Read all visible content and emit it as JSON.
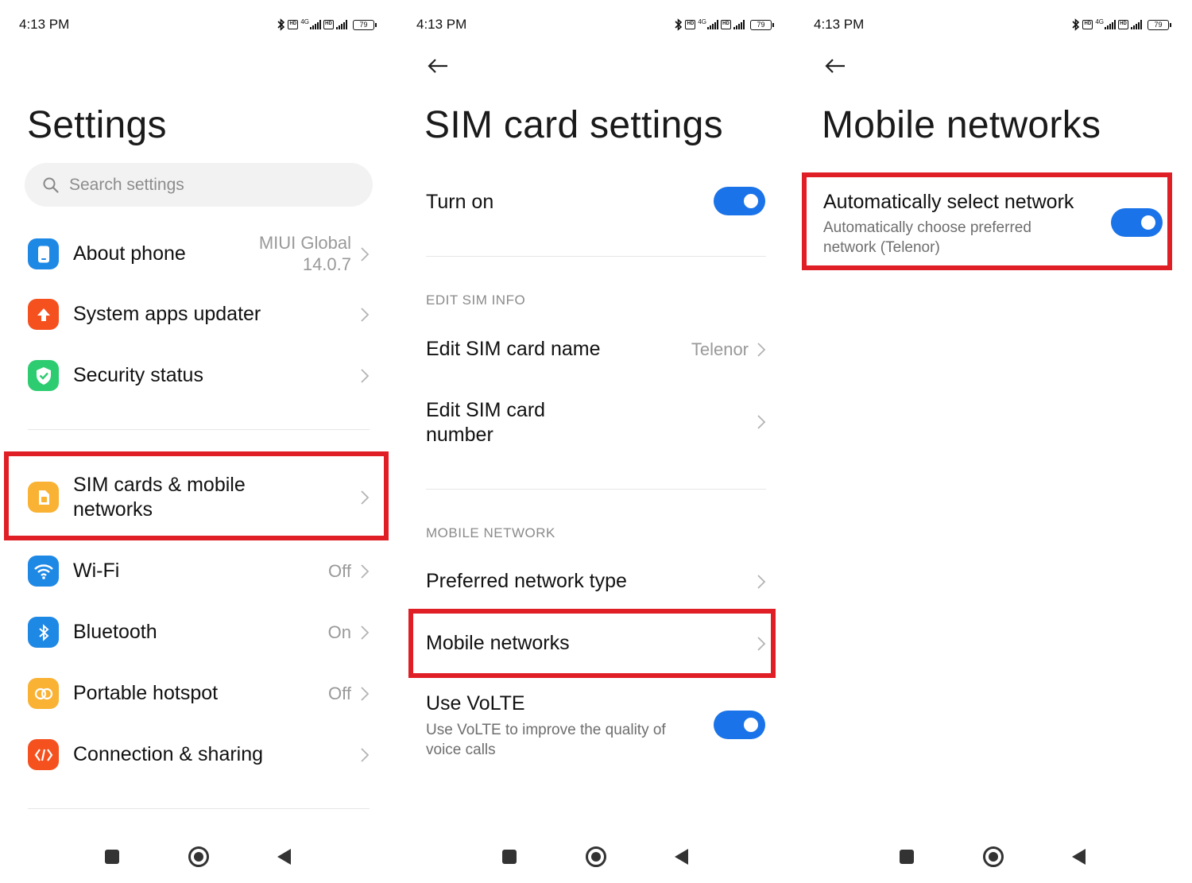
{
  "status_bar": {
    "time": "4:13 PM",
    "battery": "79",
    "network_label": "4G"
  },
  "screen1": {
    "title": "Settings",
    "search_placeholder": "Search settings",
    "items": [
      {
        "label": "About phone",
        "value_line1": "MIUI Global",
        "value_line2": "14.0.7",
        "icon": "phone-icon",
        "color": "#1e88e5"
      },
      {
        "label": "System apps updater",
        "value": "",
        "icon": "arrow-up-icon",
        "color": "#f4511e"
      },
      {
        "label": "Security status",
        "value": "",
        "icon": "shield-check-icon",
        "color": "#2ecc71"
      },
      {
        "label_line1": "SIM cards & mobile",
        "label_line2": "networks",
        "value": "",
        "icon": "sim-card-icon",
        "color": "#f9b233"
      },
      {
        "label": "Wi-Fi",
        "value": "Off",
        "icon": "wifi-icon",
        "color": "#1e88e5"
      },
      {
        "label": "Bluetooth",
        "value": "On",
        "icon": "bluetooth-icon",
        "color": "#1e88e5"
      },
      {
        "label": "Portable hotspot",
        "value": "Off",
        "icon": "hotspot-icon",
        "color": "#f9b233"
      },
      {
        "label": "Connection & sharing",
        "value": "",
        "icon": "share-icon",
        "color": "#f4511e"
      }
    ]
  },
  "screen2": {
    "title": "SIM card settings",
    "turn_on_label": "Turn on",
    "turn_on_state": true,
    "section_edit": "EDIT SIM INFO",
    "edit_name_label": "Edit SIM card name",
    "edit_name_value": "Telenor",
    "edit_number_line1": "Edit SIM card",
    "edit_number_line2": "number",
    "section_mobile": "MOBILE NETWORK",
    "preferred_label": "Preferred network type",
    "mobile_networks_label": "Mobile networks",
    "volte_label": "Use VoLTE",
    "volte_desc_line1": "Use VoLTE to improve the quality of",
    "volte_desc_line2": "voice calls",
    "volte_state": true
  },
  "screen3": {
    "title": "Mobile networks",
    "auto_label": "Automatically select network",
    "auto_desc_line1": "Automatically choose preferred",
    "auto_desc_line2": "network (Telenor)",
    "auto_state": true
  },
  "colors": {
    "accent": "#1a73e8",
    "highlight": "#e01e26"
  }
}
